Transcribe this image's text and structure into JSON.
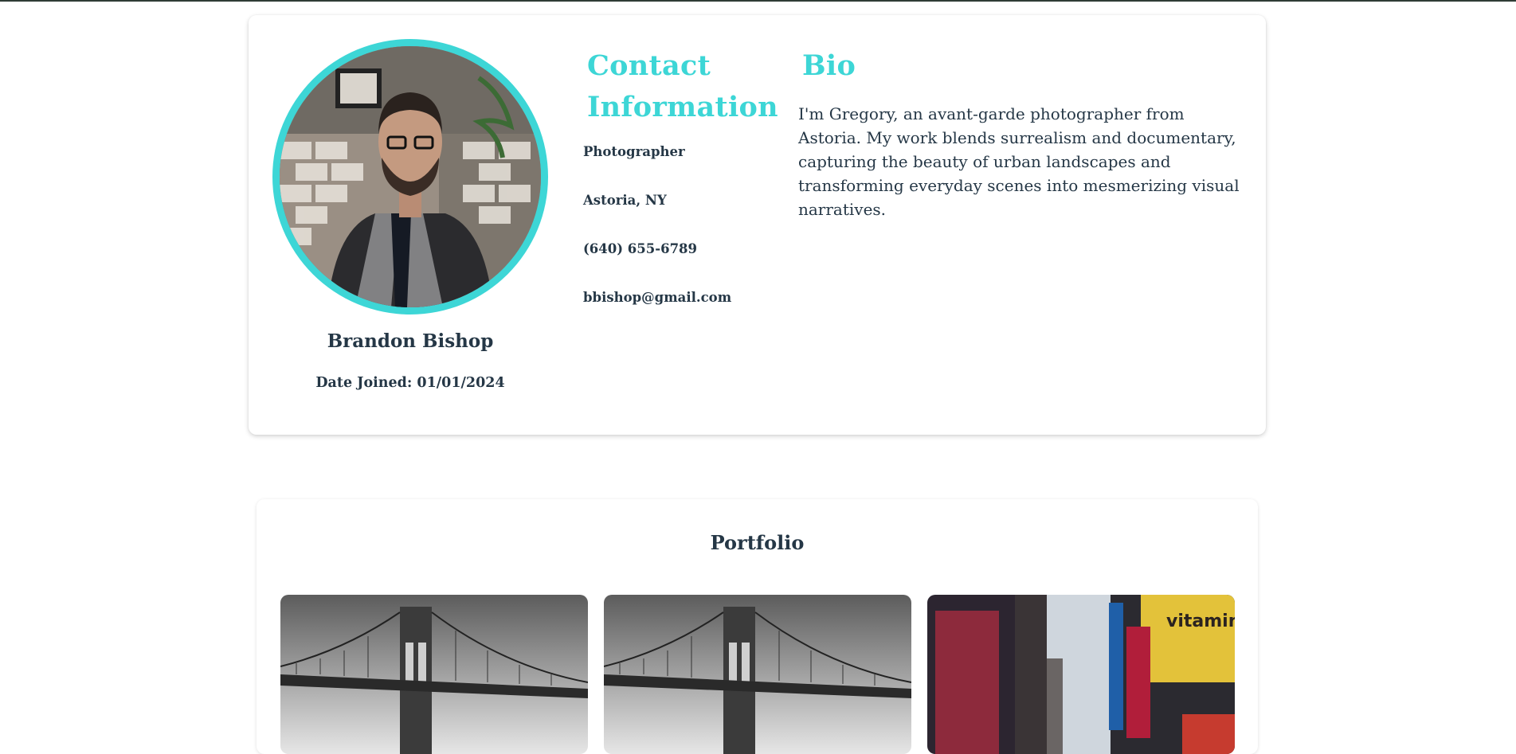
{
  "profile": {
    "name": "Brandon Bishop",
    "date_joined": "Date Joined: 01/01/2024",
    "avatar_icon": "profile-photo"
  },
  "contact": {
    "heading": "Contact Information",
    "items": [
      "Photographer",
      "Astoria, NY",
      "(640) 655-6789",
      "bbishop@gmail.com"
    ]
  },
  "bio": {
    "heading": "Bio",
    "text": "I'm Gregory, an avant-garde photographer from Astoria. My work blends surrealism and documentary, capturing the beauty of urban landscapes and transforming everyday scenes into mesmerizing visual narratives."
  },
  "portfolio": {
    "title": "Portfolio",
    "images": [
      {
        "subject": "bridge-photo"
      },
      {
        "subject": "bridge-photo"
      },
      {
        "subject": "city-street-photo",
        "sign_text": "vitamin"
      }
    ]
  },
  "colors": {
    "accent": "#3dd6d6",
    "text": "#253746"
  }
}
